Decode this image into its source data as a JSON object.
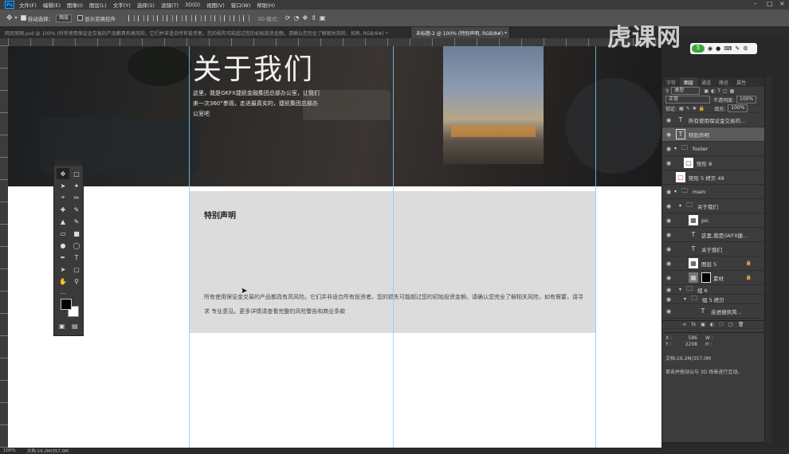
{
  "menubar": {
    "app_icon": "Ps",
    "items": [
      "文件(F)",
      "编辑(E)",
      "图像(I)",
      "图层(L)",
      "文字(Y)",
      "选择(S)",
      "滤镜(T)",
      "3D(D)",
      "视图(V)",
      "窗口(W)",
      "帮助(H)"
    ]
  },
  "options": {
    "auto_select_label": "自动选择：",
    "auto_select_value": "图层",
    "show_transform_label": "显示变换控件",
    "mode_3d_label": "3D 模式："
  },
  "tabs": [
    {
      "label": "网页原图.psd @ 100% (所有使用保证金交易的产品都具有高风险。它们并非适合所有投资者。您的损失可能超过您的初始投资金额。请确认您完全了解相关风险，如有, RGB/8#) *"
    },
    {
      "label": "未标题-2 @ 100% (特别声明, RGB/8#) *"
    }
  ],
  "canvas": {
    "about_title": "关于我们",
    "about_text": "这里，我是GKFX捷凯金融集团总部办公室，让我们来一次360°参观，走进最真实的，捷凯集团总部办公室吧",
    "notice_title": "特别声明",
    "notice_body": "所有使用保证金交易的产品都具有高风险。它们并非适合所有投资者。您的损失可能超过您的初始投资金额。请确认您完全了解相关风险，如有需要，请寻求 专业意见。更多详情请查看完整的风险警告和商业条款"
  },
  "watermark": {
    "text": "虎课网",
    "badge_icon": "5"
  },
  "layers_panel": {
    "tabs": [
      "字符",
      "图层",
      "通道",
      "路径",
      "属性"
    ],
    "filter_label": "类型",
    "blend_mode": "正常",
    "opacity_label": "不透明度:",
    "opacity_value": "100%",
    "lock_label": "锁定:",
    "fill_label": "填充:",
    "fill_value": "100%",
    "layers": [
      {
        "name": "所有使用保证金交易的...",
        "kind": "T",
        "selected": false,
        "indent": 0
      },
      {
        "name": "特别声明",
        "kind": "T",
        "selected": true,
        "indent": 0
      },
      {
        "name": "footer",
        "kind": "folder",
        "selected": false,
        "indent": 0
      },
      {
        "name": "矩形 8",
        "kind": "shape",
        "selected": false,
        "indent": 1
      },
      {
        "name": "矩形 5 拷贝 49",
        "kind": "shape",
        "selected": false,
        "indent": 0
      },
      {
        "name": "main",
        "kind": "folder",
        "selected": false,
        "indent": 0
      },
      {
        "name": "关于我们",
        "kind": "folder",
        "selected": false,
        "indent": 1
      },
      {
        "name": "pic",
        "kind": "image",
        "selected": false,
        "indent": 2
      },
      {
        "name": "这里,我是GKFX捷...",
        "kind": "T",
        "selected": false,
        "indent": 2
      },
      {
        "name": "关于我们",
        "kind": "T",
        "selected": false,
        "indent": 2
      },
      {
        "name": "图层 5",
        "kind": "image",
        "selected": false,
        "indent": 2
      },
      {
        "name": "素材",
        "kind": "image",
        "selected": false,
        "indent": 2
      },
      {
        "name": "组 6",
        "kind": "folder",
        "selected": false,
        "indent": 1
      },
      {
        "name": "组 5 拷贝",
        "kind": "folder",
        "selected": false,
        "indent": 2
      },
      {
        "name": "走进捷凯简...",
        "kind": "T",
        "selected": false,
        "indent": 3
      }
    ]
  },
  "info": {
    "x_label": "X :",
    "x_value": "586",
    "y_label": "Y :",
    "y_value": "2208",
    "w_label": "W :",
    "h_label": "H :",
    "doc_size": "文档:19.2M/357.0M",
    "hint": "单击并拖动以与 3D 场景进行互动。"
  },
  "status": {
    "zoom": "100%",
    "doc": "文档:19.2M/357.0M"
  }
}
